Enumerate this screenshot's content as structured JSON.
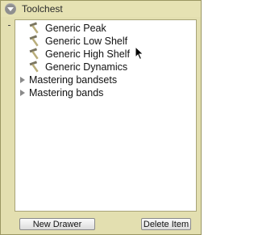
{
  "panel": {
    "title": "Toolchest"
  },
  "tree": {
    "children": [
      {
        "label": "Generic Peak",
        "icon": "hammer-icon"
      },
      {
        "label": "Generic Low Shelf",
        "icon": "hammer-icon"
      },
      {
        "label": "Generic High Shelf",
        "icon": "hammer-icon"
      },
      {
        "label": "Generic Dynamics",
        "icon": "hammer-icon"
      }
    ],
    "groups": [
      {
        "label": "Mastering bandsets",
        "expanded": false
      },
      {
        "label": "Mastering bands",
        "expanded": false
      }
    ]
  },
  "buttons": {
    "new_drawer": "New Drawer",
    "delete_item": "Delete Item"
  },
  "colors": {
    "panel_bg": "#e3dfb0",
    "tree_bg": "#ffffff"
  }
}
